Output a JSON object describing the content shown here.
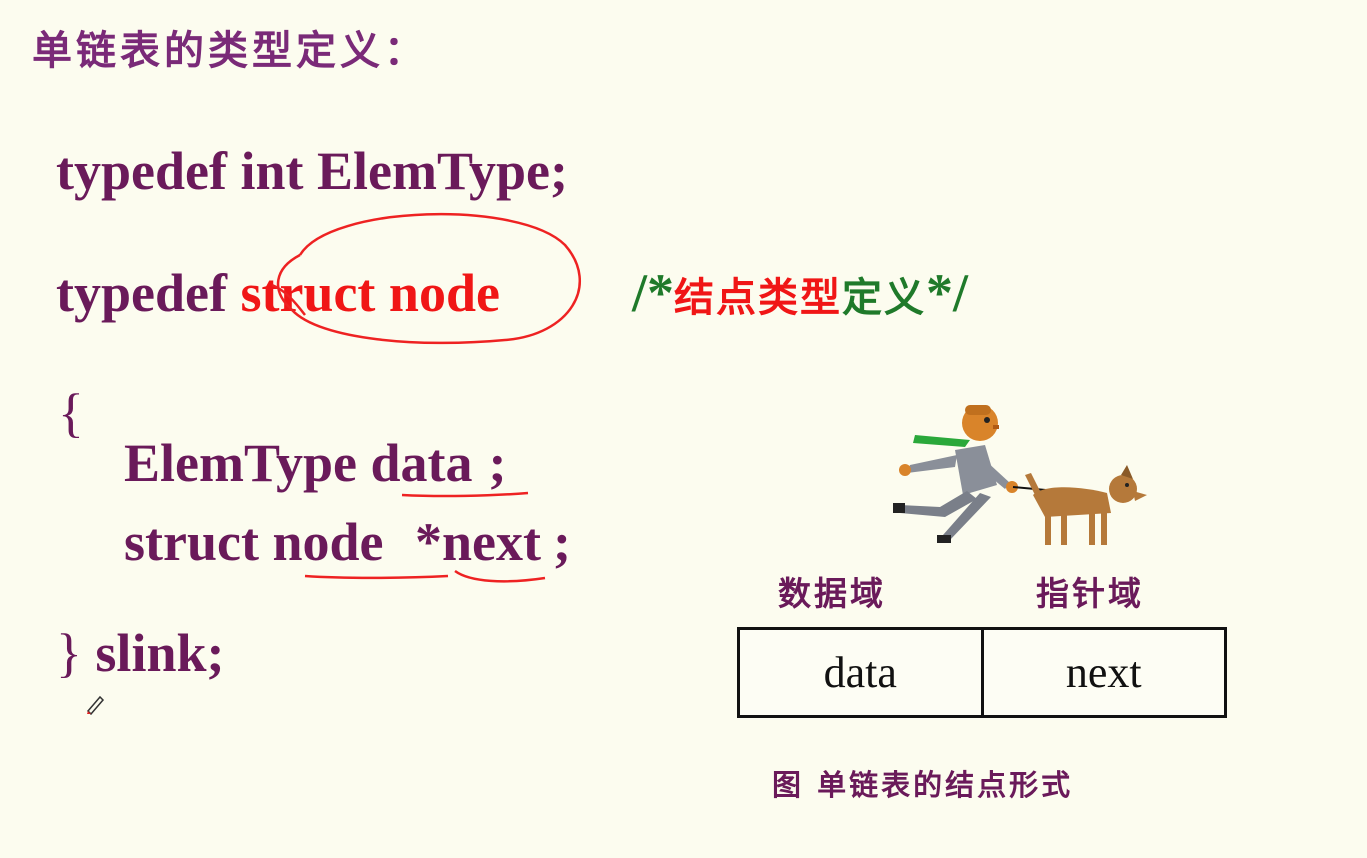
{
  "heading": "单链表的类型定义：",
  "code": {
    "line1": "typedef int ElemType;",
    "line2_keyword": "typedef",
    "line2_struct": "struct node",
    "comment_open": "/*",
    "comment_red": "结点类型",
    "comment_green": "定义",
    "comment_close": "*/",
    "open_brace": "{",
    "line3_type": "ElemType",
    "line3_field": "data",
    "line3_semi": ";",
    "line4_kw": "struct",
    "line4_node": "node",
    "line4_next": "*next",
    "line4_semi": ";",
    "close_brace": "}",
    "close_name": "slink",
    "close_semi": ";"
  },
  "diagram": {
    "label_data_field": "数据域",
    "label_pointer_field": "指针域",
    "cell_data": "data",
    "cell_next": "next",
    "caption": "图 单链表的结点形式"
  },
  "colors": {
    "background": "#fcfcef",
    "text_purple": "#6a1a5a",
    "accent_red": "#f01616",
    "comment_green": "#1f7a2a"
  }
}
